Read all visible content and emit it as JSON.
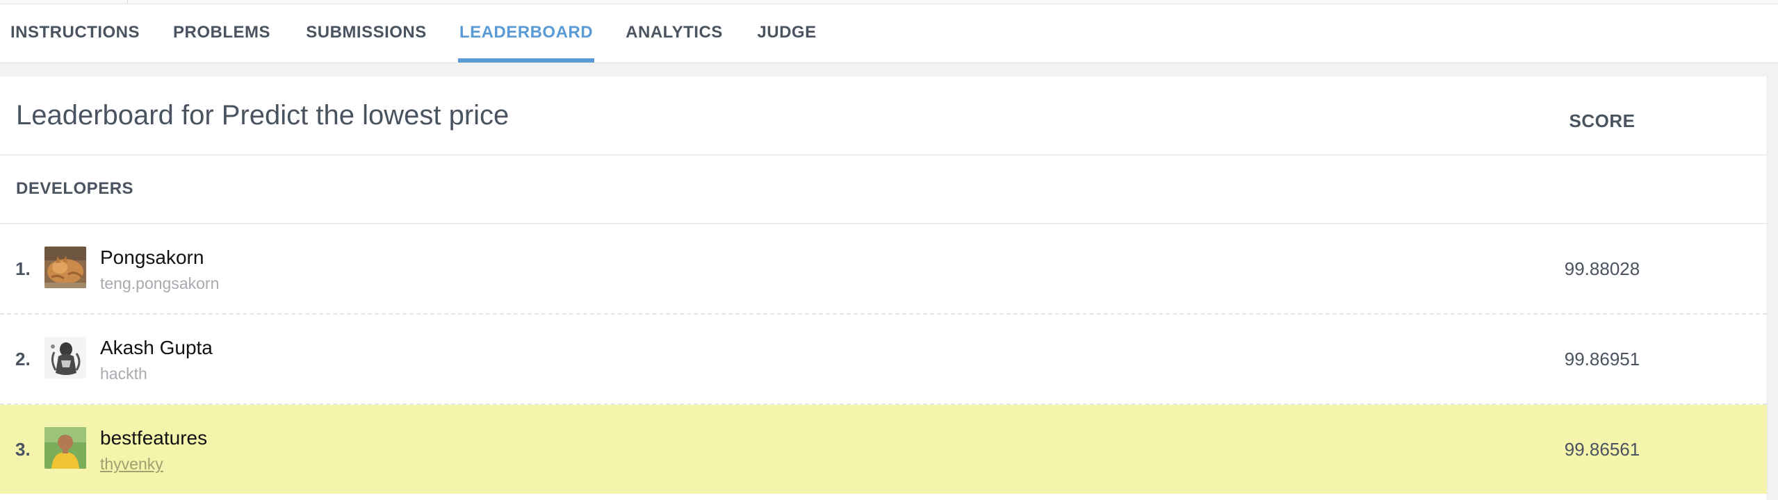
{
  "tabs": [
    {
      "label": "INSTRUCTIONS",
      "active": false
    },
    {
      "label": "PROBLEMS",
      "active": false
    },
    {
      "label": "SUBMISSIONS",
      "active": false
    },
    {
      "label": "LEADERBOARD",
      "active": true
    },
    {
      "label": "ANALYTICS",
      "active": false
    },
    {
      "label": "JUDGE",
      "active": false
    }
  ],
  "leaderboard": {
    "title": "Leaderboard for Predict the lowest price",
    "columns": {
      "developers": "DEVELOPERS",
      "score": "SCORE"
    },
    "rows": [
      {
        "rank": "1.",
        "name": "Pongsakorn",
        "handle": "teng.pongsakorn",
        "score": "99.88028",
        "avatar_icon": "cat-avatar-icon",
        "highlighted": false
      },
      {
        "rank": "2.",
        "name": "Akash Gupta",
        "handle": "hackth",
        "score": "99.86951",
        "avatar_icon": "figure-avatar-icon",
        "highlighted": false
      },
      {
        "rank": "3.",
        "name": "bestfeatures",
        "handle": "thyvenky",
        "score": "99.86561",
        "avatar_icon": "person-avatar-icon",
        "highlighted": true
      }
    ]
  },
  "colors": {
    "accent": "#5b9bd5",
    "text": "#4a5360",
    "highlight_row": "#f4f4ad"
  }
}
